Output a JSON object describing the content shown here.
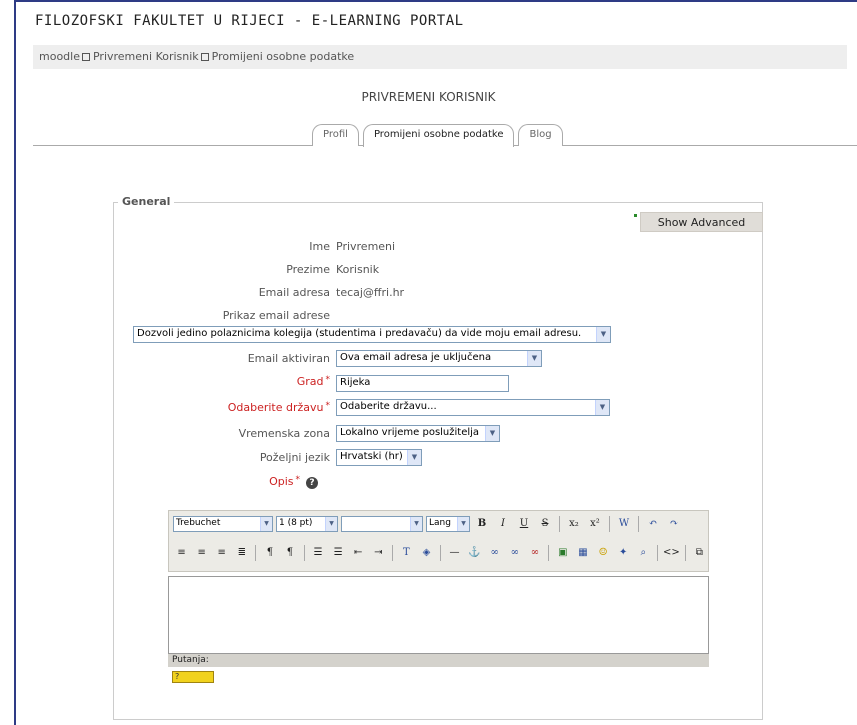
{
  "site": {
    "title": "FILOZOFSKI FAKULTET U RIJECI - E-LEARNING PORTAL"
  },
  "breadcrumb": [
    "moodle",
    "Privremeni Korisnik",
    "Promijeni osobne podatke"
  ],
  "user": {
    "full_name": "PRIVREMENI KORISNIK"
  },
  "tabs": [
    {
      "label": "Profil"
    },
    {
      "label": "Promijeni osobne podatke",
      "active": true
    },
    {
      "label": "Blog"
    }
  ],
  "form": {
    "legend": "General",
    "show_advanced_label": "Show Advanced",
    "ime": {
      "label": "Ime",
      "value": "Privremeni"
    },
    "prezime": {
      "label": "Prezime",
      "value": "Korisnik"
    },
    "email": {
      "label": "Email adresa",
      "value": "tecaj@ffri.hr"
    },
    "email_display": {
      "label": "Prikaz email adrese",
      "value": "Dozvoli jedino polaznicima kolegija (studentima i predavaču) da vide moju email adresu."
    },
    "email_active": {
      "label": "Email aktiviran",
      "value": "Ova email adresa je uključena"
    },
    "city": {
      "label": "Grad",
      "value": "Rijeka"
    },
    "country": {
      "label": "Odaberite državu",
      "value": "Odaberite državu..."
    },
    "timezone": {
      "label": "Vremenska zona",
      "value": "Lokalno vrijeme poslužitelja"
    },
    "language": {
      "label": "Poželjni jezik",
      "value": "Hrvatski (hr)"
    },
    "description": {
      "label": "Opis"
    },
    "required_mark": "*"
  },
  "editor": {
    "font_family": "Trebuchet",
    "font_size": "1 (8 pt)",
    "format": "",
    "lang": "Lang",
    "row1_buttons": [
      "B",
      "I",
      "U",
      "S",
      "x₂",
      "x²",
      "W",
      "↶",
      "↷"
    ],
    "path_label": "Putanja:",
    "hint_badge": "?"
  },
  "colors": {
    "accent": "#2e3b85",
    "required": "#cc2222",
    "nav_bg": "#eeeeee",
    "button_bg": "#e0ddd8"
  }
}
